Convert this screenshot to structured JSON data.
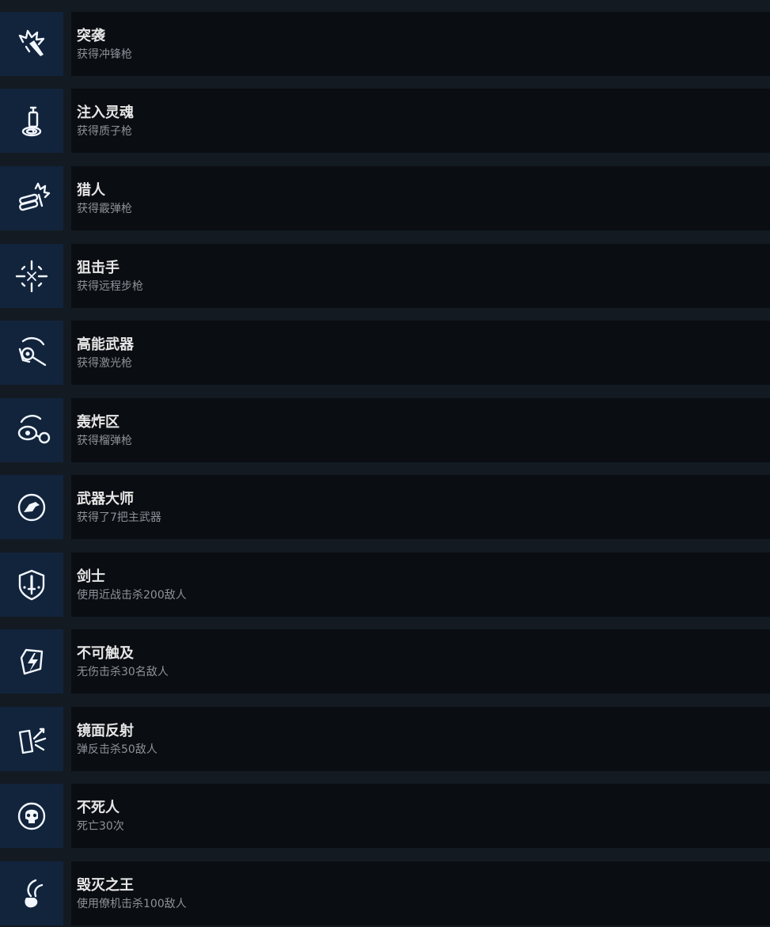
{
  "achievements": [
    {
      "title": "突袭",
      "description": "获得冲锋枪",
      "icon": "burst-gun-icon"
    },
    {
      "title": "注入灵魂",
      "description": "获得质子枪",
      "icon": "syringe-icon"
    },
    {
      "title": "猎人",
      "description": "获得霰弹枪",
      "icon": "shotgun-shells-icon"
    },
    {
      "title": "狙击手",
      "description": "获得远程步枪",
      "icon": "crosshair-icon"
    },
    {
      "title": "高能武器",
      "description": "获得激光枪",
      "icon": "laser-gun-icon"
    },
    {
      "title": "轰炸区",
      "description": "获得榴弹枪",
      "icon": "grenade-launcher-icon"
    },
    {
      "title": "武器大师",
      "description": "获得了7把主武器",
      "icon": "eagle-emblem-icon"
    },
    {
      "title": "剑士",
      "description": "使用近战击杀200敌人",
      "icon": "sword-shield-icon"
    },
    {
      "title": "不可触及",
      "description": "无伤击杀30名敌人",
      "icon": "lightning-shield-icon"
    },
    {
      "title": "镜面反射",
      "description": "弹反击杀50敌人",
      "icon": "deflect-icon"
    },
    {
      "title": "不死人",
      "description": "死亡30次",
      "icon": "skull-orb-icon"
    },
    {
      "title": "毁灭之王",
      "description": "使用僚机击杀100敌人",
      "icon": "claw-drone-icon"
    }
  ]
}
